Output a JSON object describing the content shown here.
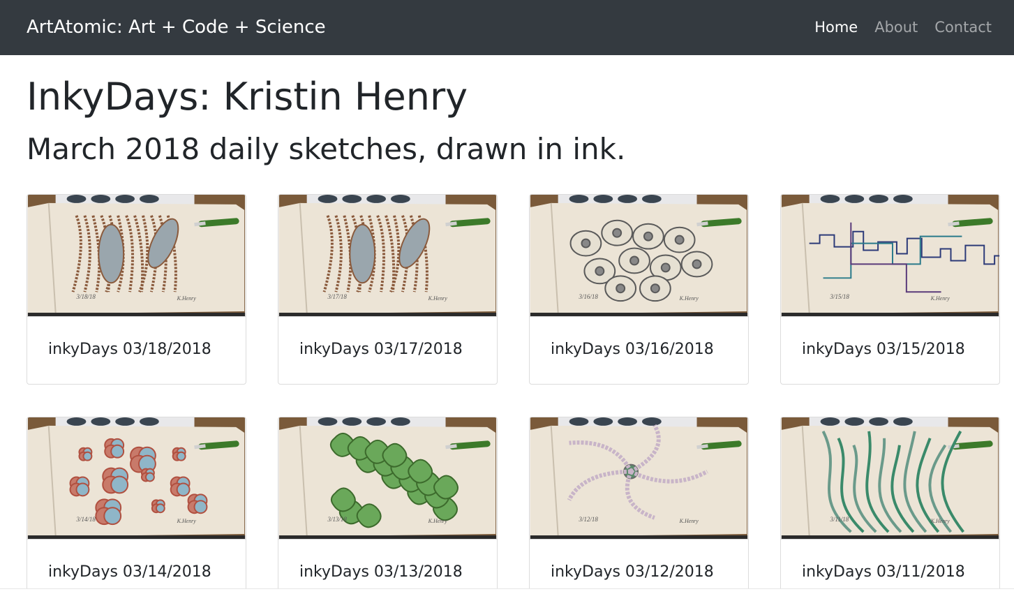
{
  "navbar": {
    "brand": "ArtAtomic: Art + Code + Science",
    "links": [
      {
        "label": "Home",
        "active": true
      },
      {
        "label": "About",
        "active": false
      },
      {
        "label": "Contact",
        "active": false
      }
    ]
  },
  "header": {
    "title": "InkyDays: Kristin Henry",
    "subtitle": "March 2018 daily sketches, drawn in ink."
  },
  "gallery": {
    "cards": [
      {
        "label": "inkyDays 03/18/2018",
        "sketch_date": "3/18/18",
        "signature": "K.Henry",
        "subject": "mitochondria",
        "ink": "#8a5a3c"
      },
      {
        "label": "inkyDays 03/17/2018",
        "sketch_date": "3/17/18",
        "signature": "K.Henry",
        "subject": "mitochondria",
        "ink": "#8a5a3c"
      },
      {
        "label": "inkyDays 03/16/2018",
        "sketch_date": "3/16/18",
        "signature": "K.Henry",
        "subject": "cells",
        "ink": "#5a5a5a"
      },
      {
        "label": "inkyDays 03/15/2018",
        "sketch_date": "3/15/18",
        "signature": "K.Henry",
        "subject": "circuit",
        "ink": "#2c3a78"
      },
      {
        "label": "inkyDays 03/14/2018",
        "sketch_date": "3/14/18",
        "signature": "K.Henry",
        "subject": "cell-clusters",
        "ink": "#b05040"
      },
      {
        "label": "inkyDays 03/13/2018",
        "sketch_date": "3/13/18",
        "signature": "K.Henry",
        "subject": "lichen",
        "ink": "#4a8a3c"
      },
      {
        "label": "inkyDays 03/12/2018",
        "sketch_date": "3/12/18",
        "signature": "K.Henry",
        "subject": "brittle-star",
        "ink": "#6a6a6a"
      },
      {
        "label": "inkyDays 03/11/2018",
        "sketch_date": "3/11/18",
        "signature": "K.Henry",
        "subject": "seaweed",
        "ink": "#2e7a5a"
      }
    ]
  },
  "colors": {
    "navbar_bg": "#343a40",
    "text": "#212529",
    "card_border": "#dcdcdc"
  }
}
